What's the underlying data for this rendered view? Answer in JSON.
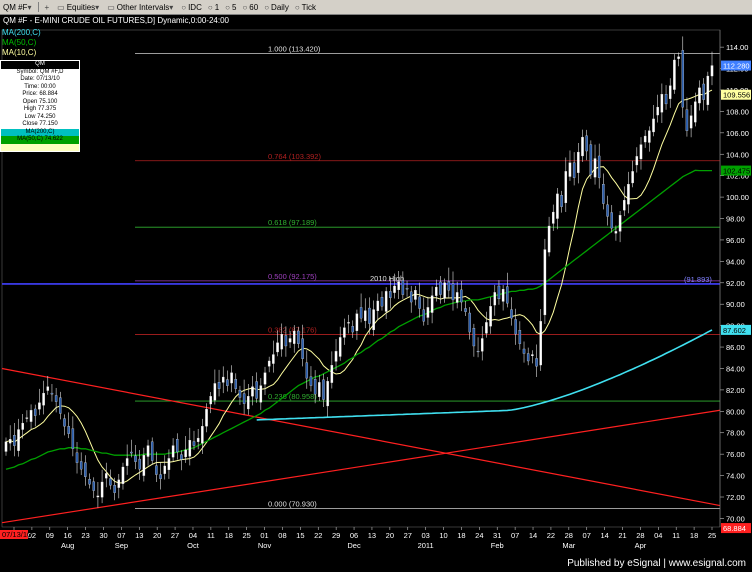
{
  "toolbar": {
    "symbol": "QM #F",
    "equities": "Equities",
    "other_intervals": "Other Intervals",
    "idc": "IDC",
    "i1": "1",
    "i5": "5",
    "i60": "60",
    "daily": "Daily",
    "tick": "Tick"
  },
  "chart_title": "QM #F - E-MINI CRUDE OIL FUTURES,D] Dynamic,0:00-24:00",
  "ma_labels": {
    "ma200": "MA(200,C)",
    "ma50": "MA(50,C)",
    "ma10": "MA(10,C)"
  },
  "info_box": {
    "header": "QM",
    "rows": [
      "Symbol: QM #F,D",
      "Date: 07/13/10",
      "Time: 00:00",
      "Price: 68.884",
      "Open 75.100",
      "High 77.375",
      "Low 74.250",
      "Close 77.150"
    ],
    "ma_rows": [
      "MA(200,C)",
      "MA(50,C) 74.622",
      ""
    ]
  },
  "footer": {
    "published": "Published by eSignal | www.esignal.com"
  },
  "colors": {
    "background": "#000000",
    "up_candle": "#ffffff",
    "down_candle": "#2a5caa",
    "ma10": "#ffffa0",
    "ma50": "#00a000",
    "ma200": "#40e0f0",
    "fib_line": "#a02020",
    "trend_line": "#ff2020",
    "high_line": "#4040ff"
  },
  "chart_data": {
    "type": "candlestick",
    "ylim": [
      69.2,
      115.6
    ],
    "y_ticks": [
      70,
      72,
      74,
      76,
      78,
      80,
      82,
      84,
      86,
      88,
      90,
      92,
      94,
      96,
      98,
      100,
      102,
      104,
      106,
      108,
      110,
      112,
      114
    ],
    "y_tick_labels": [
      "70.00",
      "72.00",
      "74.00",
      "76.00",
      "78.00",
      "80.00",
      "82.00",
      "84.00",
      "86.00",
      "88.00",
      "90.00",
      "92.00",
      "94.00",
      "96.00",
      "98.00",
      "100.00",
      "102.00",
      "104.00",
      "106.00",
      "108.00",
      "110.00",
      "112.00",
      "114.00"
    ],
    "x_day_labels": [
      "26",
      "02",
      "09",
      "16",
      "23",
      "30",
      "07",
      "13",
      "20",
      "27",
      "04",
      "11",
      "18",
      "25",
      "01",
      "08",
      "15",
      "22",
      "29",
      "06",
      "13",
      "20",
      "27",
      "03",
      "10",
      "18",
      "24",
      "31",
      "07",
      "14",
      "22",
      "28",
      "07",
      "14",
      "21",
      "28",
      "04",
      "11",
      "18",
      "25"
    ],
    "x_month_labels": [
      {
        "label": "Aug",
        "index": 3
      },
      {
        "label": "Sep",
        "index": 6
      },
      {
        "label": "Oct",
        "index": 10
      },
      {
        "label": "Nov",
        "index": 14
      },
      {
        "label": "Dec",
        "index": 19
      },
      {
        "label": "2011",
        "index": 23
      },
      {
        "label": "Feb",
        "index": 27
      },
      {
        "label": "Mar",
        "index": 31
      },
      {
        "label": "Apr",
        "index": 35
      }
    ],
    "fib_levels": [
      {
        "label": "1.000 (113.420)",
        "value": 113.42
      },
      {
        "label": "0.764 (103.392)",
        "value": 103.392
      },
      {
        "label": "0.618 (97.189)",
        "value": 97.189
      },
      {
        "label": "0.500 (92.175)",
        "value": 92.175
      },
      {
        "label": "0.382 (87.176)",
        "value": 87.176
      },
      {
        "label": "0.236 (80.958)",
        "value": 80.958
      },
      {
        "label": "0.000 (70.930)",
        "value": 70.93
      }
    ],
    "high_line": {
      "label": "2010 High",
      "value": 91.893,
      "value_label": "(91.893)"
    },
    "price_badges": [
      {
        "label": "112.280",
        "value": 112.28,
        "color": "#4080ff"
      },
      {
        "label": "109.556",
        "value": 109.556,
        "color": "#ffffa0"
      },
      {
        "label": "102.475",
        "value": 102.475,
        "color": "#00a000"
      },
      {
        "label": "87.602",
        "value": 87.602,
        "color": "#40e0f0"
      },
      {
        "label": "68.884",
        "value": 69.1,
        "color": "#ff2020"
      }
    ],
    "date_badge": "07/13/10",
    "candles_close": [
      77.15,
      77.4,
      76.8,
      78.3,
      78.9,
      79.4,
      80.1,
      79.6,
      80.8,
      81.7,
      82.3,
      81.6,
      80.9,
      79.8,
      78.6,
      77.9,
      76.5,
      75.2,
      74.6,
      73.9,
      73.2,
      72.6,
      72.1,
      73.4,
      74.2,
      73.1,
      72.4,
      73.6,
      74.8,
      75.6,
      76.1,
      75.3,
      74.6,
      75.9,
      76.8,
      75.4,
      74.1,
      73.7,
      74.9,
      75.6,
      76.8,
      76.2,
      75.5,
      76.4,
      77.3,
      76.8,
      77.5,
      78.6,
      80.2,
      81.4,
      82.6,
      82.1,
      83.2,
      82.4,
      83.6,
      82.1,
      81.3,
      80.7,
      81.4,
      82.3,
      81.2,
      82.4,
      83.6,
      84.7,
      85.3,
      86.4,
      87.2,
      86.1,
      86.8,
      87.5,
      86.3,
      84.9,
      83.1,
      82.4,
      81.6,
      82.7,
      81.1,
      82.8,
      84.3,
      85.6,
      86.9,
      87.8,
      88.3,
      87.4,
      89.1,
      88.7,
      89.4,
      88.2,
      89.5,
      90.3,
      89.8,
      91.2,
      90.6,
      91.7,
      92.1,
      90.9,
      91.4,
      90.2,
      91.3,
      89.6,
      88.4,
      89.7,
      90.8,
      91.6,
      90.9,
      92.0,
      91.3,
      90.4,
      91.1,
      90.2,
      89.3,
      87.4,
      86.1,
      85.6,
      86.8,
      88.3,
      89.8,
      91.1,
      90.5,
      91.4,
      90.1,
      88.7,
      87.2,
      86.3,
      85.4,
      84.7,
      85.3,
      84.2,
      88.4,
      95.1,
      97.3,
      98.6,
      100.3,
      99.1,
      102.4,
      103.2,
      101.8,
      104.2,
      105.6,
      104.3,
      102.1,
      103.6,
      101.8,
      99.4,
      98.2,
      97.1,
      96.8,
      98.3,
      99.7,
      101.2,
      102.4,
      103.8,
      104.9,
      105.7,
      106.2,
      107.3,
      108.4,
      109.6,
      108.7,
      110.4,
      112.8,
      113.1,
      108.4,
      106.2,
      107.6,
      108.9,
      110.2,
      109.1,
      111.3,
      112.28
    ],
    "ma50": [
      74.6,
      74.7,
      74.8,
      75.0,
      75.1,
      75.3,
      75.5,
      75.6,
      75.8,
      76.0,
      76.2,
      76.3,
      76.4,
      76.5,
      76.5,
      76.6,
      76.6,
      76.6,
      76.5,
      76.5,
      76.4,
      76.3,
      76.2,
      76.1,
      76.1,
      76.0,
      75.9,
      75.9,
      75.9,
      75.9,
      75.9,
      75.9,
      75.9,
      76.0,
      76.0,
      76.0,
      76.0,
      76.0,
      76.0,
      76.1,
      76.1,
      76.2,
      76.3,
      76.4,
      76.5,
      76.6,
      76.8,
      77.0,
      77.2,
      77.4,
      77.6,
      77.8,
      78.0,
      78.2,
      78.4,
      78.6,
      78.8,
      79.0,
      79.2,
      79.4,
      79.6,
      79.8,
      80.1,
      80.3,
      80.6,
      80.9,
      81.2,
      81.5,
      81.8,
      82.1,
      82.4,
      82.6,
      82.8,
      83.0,
      83.2,
      83.3,
      83.5,
      83.7,
      83.9,
      84.1,
      84.3,
      84.5,
      84.8,
      85.0,
      85.3,
      85.5,
      85.8,
      86.0,
      86.3,
      86.6,
      86.8,
      87.1,
      87.4,
      87.6,
      87.9,
      88.1,
      88.3,
      88.5,
      88.7,
      88.9,
      89.0,
      89.2,
      89.4,
      89.6,
      89.7,
      89.9,
      90.0,
      90.1,
      90.2,
      90.3,
      90.3,
      90.4,
      90.4,
      90.4,
      90.5,
      90.6,
      90.7,
      90.8,
      90.9,
      91.0,
      91.1,
      91.2,
      91.2,
      91.3,
      91.3,
      91.4,
      91.4,
      91.5,
      91.7,
      92.0,
      92.3,
      92.6,
      92.9,
      93.2,
      93.5,
      93.8,
      94.1,
      94.4,
      94.7,
      95.0,
      95.3,
      95.6,
      95.9,
      96.2,
      96.5,
      96.8,
      97.1,
      97.4,
      97.7,
      98.0,
      98.3,
      98.6,
      98.9,
      99.2,
      99.5,
      99.8,
      100.1,
      100.4,
      100.7,
      101.0,
      101.3,
      101.6,
      101.9,
      102.1,
      102.3,
      102.5,
      102.475,
      102.475,
      102.475,
      102.475
    ]
  }
}
